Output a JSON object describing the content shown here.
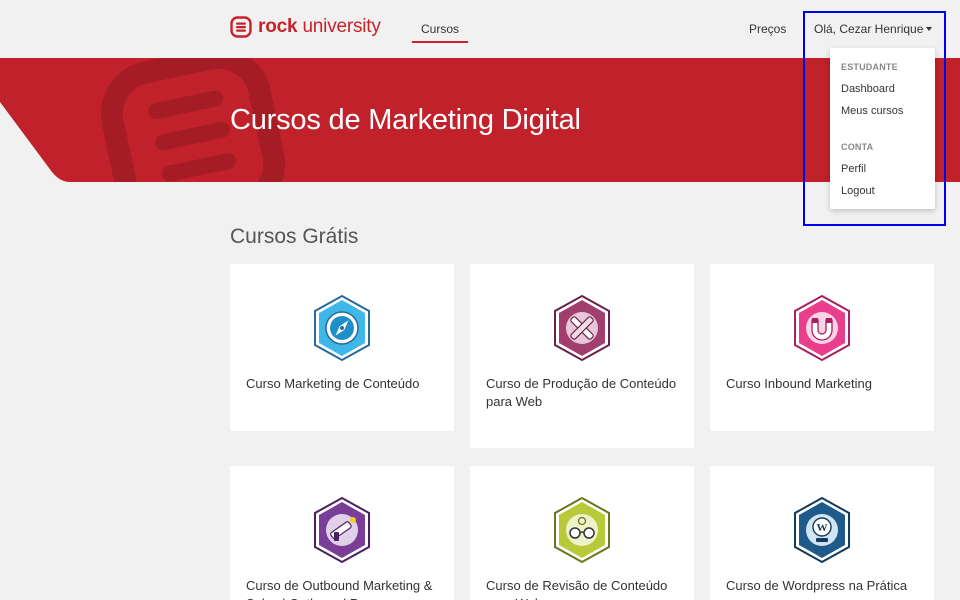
{
  "header": {
    "logo_bold": "rock",
    "logo_light": "university",
    "nav_cursos": "Cursos",
    "nav_precos": "Preços",
    "user_greeting": "Olá, Cezar Henrique"
  },
  "dropdown": {
    "section_student": "ESTUDANTE",
    "dashboard": "Dashboard",
    "my_courses": "Meus cursos",
    "section_account": "CONTA",
    "profile": "Perfil",
    "logout": "Logout"
  },
  "hero": {
    "title": "Cursos de Marketing Digital"
  },
  "section": {
    "title": "Cursos Grátis"
  },
  "courses": [
    {
      "title": "Curso Marketing de Conteúdo",
      "badge_icon": "compass-icon",
      "color": "#3fb8e8"
    },
    {
      "title": "Curso de Produção de Conteúdo para Web",
      "badge_icon": "pencil-cross-icon",
      "color": "#a13e6e"
    },
    {
      "title": "Curso Inbound Marketing",
      "badge_icon": "magnet-icon",
      "color": "#e83e8c"
    },
    {
      "title": "Curso de Outbound Marketing & Sales | Outbound Para...",
      "badge_icon": "raygun-icon",
      "color": "#7a3e96"
    },
    {
      "title": "Curso de Revisão de Conteúdo para Web",
      "badge_icon": "glasses-icon",
      "color": "#b8c93a"
    },
    {
      "title": "Curso de Wordpress na Prática",
      "badge_icon": "wordpress-icon",
      "color": "#1e5a8a"
    }
  ],
  "colors": {
    "brand_red": "#c8232a",
    "highlight": "#0000ee"
  }
}
